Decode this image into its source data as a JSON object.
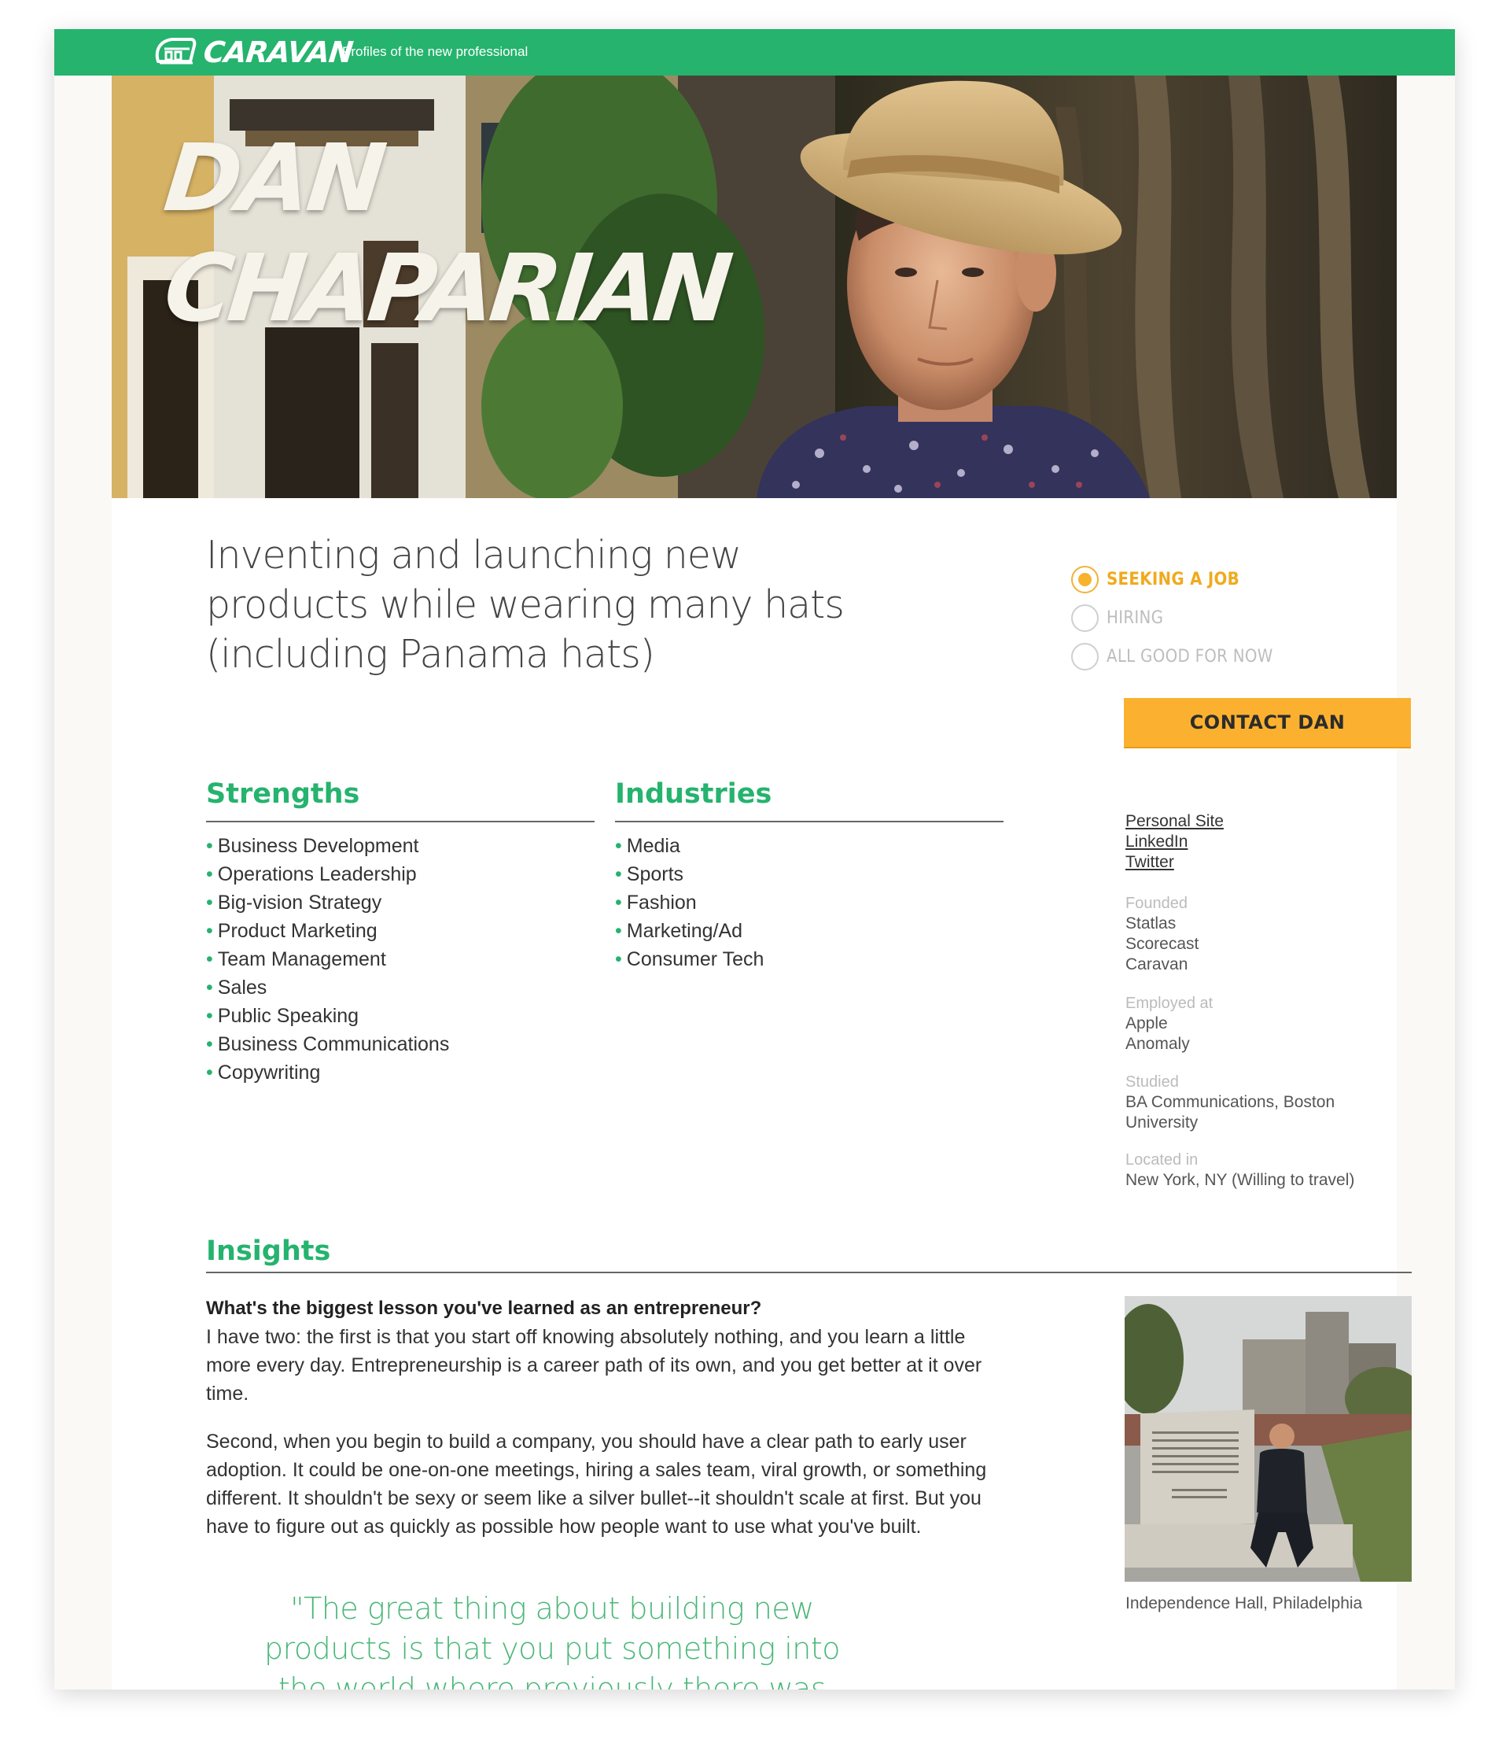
{
  "brand": {
    "name": "CARAVAN",
    "tagline": "Profiles of the new professional"
  },
  "colors": {
    "brand_green": "#25b36e",
    "accent_orange": "#fbb12f",
    "quote_green": "#49b777"
  },
  "profile": {
    "first_name": "DAN",
    "last_name": "CHAPARIAN",
    "headline": "Inventing and launching new products while wearing many hats (including Panama hats)"
  },
  "status": {
    "options": [
      {
        "label": "SEEKING A JOB",
        "selected": true
      },
      {
        "label": "HIRING",
        "selected": false
      },
      {
        "label": "ALL GOOD FOR NOW",
        "selected": false
      }
    ],
    "contact_label": "CONTACT DAN"
  },
  "strengths": {
    "title": "Strengths",
    "items": [
      "Business Development",
      "Operations Leadership",
      "Big-vision Strategy",
      "Product Marketing",
      "Team Management",
      "Sales",
      "Public Speaking",
      "Business Communications",
      "Copywriting"
    ]
  },
  "industries": {
    "title": "Industries",
    "items": [
      "Media",
      "Sports",
      "Fashion",
      "Marketing/Ad",
      "Consumer Tech"
    ]
  },
  "links": [
    "Personal Site",
    "LinkedIn",
    "Twitter"
  ],
  "meta": {
    "founded": {
      "label": "Founded",
      "values": [
        "Statlas",
        "Scorecast",
        "Caravan"
      ]
    },
    "employed": {
      "label": "Employed at",
      "values": [
        "Apple",
        "Anomaly"
      ]
    },
    "studied": {
      "label": "Studied",
      "values": [
        "BA Communications, Boston University"
      ]
    },
    "located": {
      "label": "Located in",
      "values": [
        "New York, NY (Willing to travel)"
      ]
    }
  },
  "insights": {
    "title": "Insights",
    "question": "What's the biggest lesson you've learned as an entrepreneur?",
    "paragraphs": [
      "I have two: the first is that you start off knowing absolutely nothing, and you learn a little more every day. Entrepreneurship is a career path of its own, and you get better at it over time.",
      "Second, when you begin to build a company, you should have a clear path to early user adoption. It could be one-on-one meetings, hiring a sales team, viral growth, or something different. It shouldn't be sexy or seem like a silver bullet--it shouldn't scale at first. But you have to figure out as quickly as possible how people want to use what you've built."
    ],
    "quote": "\"The great thing about building new products is that you put something into the world where previously there was nothing. You can change",
    "photo_caption": "Independence Hall, Philadelphia"
  }
}
